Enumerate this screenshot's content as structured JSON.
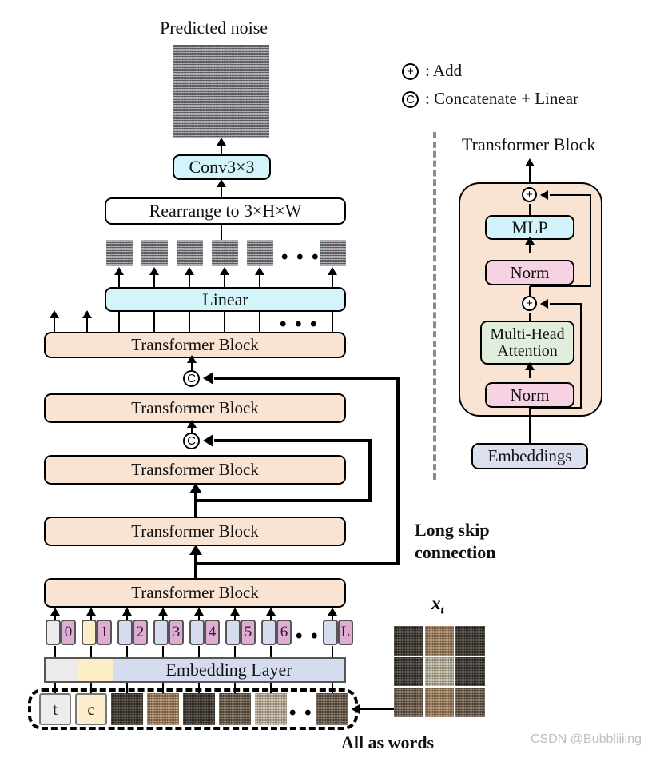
{
  "diagram": {
    "title_predicted_noise": "Predicted noise",
    "watermark": "CSDN @Bubbliiiing"
  },
  "legend": {
    "items": [
      {
        "symbol": "+",
        "text": ": Add",
        "name": "add-legend"
      },
      {
        "symbol": "C",
        "text": ": Concatenate + Linear",
        "name": "concat-legend"
      }
    ]
  },
  "main_pipeline": {
    "conv_label": "Conv3×3",
    "rearrange_label": "Rearrange to 3×H×W",
    "linear_label": "Linear",
    "transformer_block_label": "Transformer Block",
    "blocks": [
      {
        "id": "tb-top",
        "label": "Transformer Block"
      },
      {
        "id": "tb-2",
        "label": "Transformer Block"
      },
      {
        "id": "tb-3",
        "label": "Transformer Block"
      },
      {
        "id": "tb-4",
        "label": "Transformer Block"
      },
      {
        "id": "tb-bottom",
        "label": "Transformer Block"
      }
    ],
    "concat_ops": [
      {
        "id": "concat-upper",
        "symbol": "C"
      },
      {
        "id": "concat-lower",
        "symbol": "C"
      }
    ],
    "long_skip_label_line1": "Long skip",
    "long_skip_label_line2": "connection",
    "ellipsis": "• • •"
  },
  "embedding": {
    "layer_label": "Embedding Layer",
    "tokens": [
      {
        "kind": "gray",
        "index": "0"
      },
      {
        "kind": "yel",
        "index": "1"
      },
      {
        "kind": "lav",
        "index": "2"
      },
      {
        "kind": "lav",
        "index": "3"
      },
      {
        "kind": "lav",
        "index": "4"
      },
      {
        "kind": "lav",
        "index": "5"
      },
      {
        "kind": "lav",
        "index": "6"
      },
      {
        "kind": "lav",
        "index": "L"
      }
    ],
    "token_ellipsis": "• • •"
  },
  "words_row": {
    "t_label": "t",
    "c_label": "c",
    "ellipsis": "• • •",
    "caption": "All as words"
  },
  "input_image": {
    "label": "x",
    "subscript": "t"
  },
  "transformer_detail": {
    "title": "Transformer Block",
    "mlp_label": "MLP",
    "norm_upper_label": "Norm",
    "attention_label_line1": "Multi-Head",
    "attention_label_line2": "Attention",
    "norm_lower_label": "Norm",
    "embeddings_label": "Embeddings",
    "add_ops": [
      {
        "id": "add-upper",
        "symbol": "+"
      },
      {
        "id": "add-lower",
        "symbol": "+"
      }
    ]
  },
  "colors": {
    "transformer_block": "#f9e3d2",
    "linear": "#d3f4fb",
    "mlp": "#d2f3fb",
    "norm": "#f6d2e2",
    "attention": "#e1eedd",
    "embeddings": "#dbe0f1",
    "position_token": "#ddaed2",
    "patch_token": "#d6dcf0",
    "time_token": "#eceaea",
    "class_token": "#fdedc8"
  }
}
